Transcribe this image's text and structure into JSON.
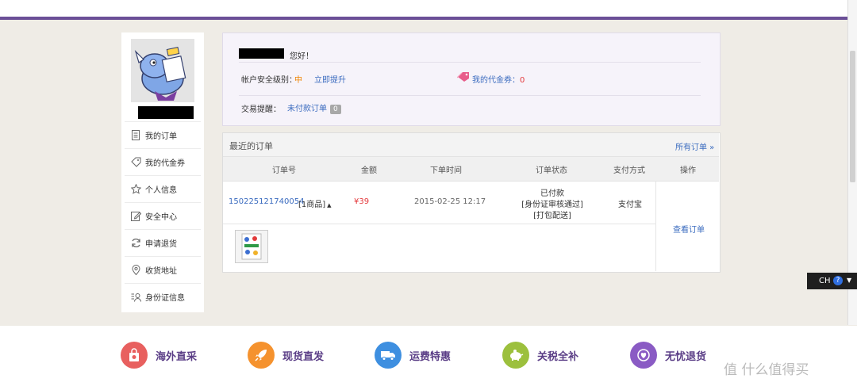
{
  "sidebar": {
    "items": [
      {
        "label": "我的订单",
        "icon": "document-icon"
      },
      {
        "label": "我的代金券",
        "icon": "tag-icon"
      },
      {
        "label": "个人信息",
        "icon": "star-icon"
      },
      {
        "label": "安全中心",
        "icon": "edit-icon"
      },
      {
        "label": "申请退货",
        "icon": "refresh-icon"
      },
      {
        "label": "收货地址",
        "icon": "location-pin-icon"
      },
      {
        "label": "身份证信息",
        "icon": "id-card-icon"
      }
    ]
  },
  "account": {
    "greeting": "您好！",
    "security_label": "帐户安全级别：",
    "security_level": "中",
    "upgrade_link": "立即提升",
    "coupon_label": "我的代金券：",
    "coupon_count": "0",
    "reminder_label": "交易提醒：",
    "unpaid_label": "未付款订单",
    "unpaid_count": "0"
  },
  "orders": {
    "title": "最近的订单",
    "all_link": "所有订单 »",
    "columns": [
      "订单号",
      "金额",
      "下单时间",
      "订单状态",
      "支付方式",
      "操作"
    ],
    "rows": [
      {
        "order_no": "150225121740054",
        "item_count": "[1商品]",
        "amount": "¥39",
        "time": "2015-02-25 12:17",
        "status": [
          "已付款",
          "[身份证审核通过]",
          "[打包配送]"
        ],
        "payment": "支付宝",
        "action": "查看订单"
      }
    ]
  },
  "features": [
    {
      "label": "海外直采",
      "color": "#e8605f",
      "icon": "shopping-bag-icon"
    },
    {
      "label": "现货直发",
      "color": "#f5922e",
      "icon": "rocket-icon"
    },
    {
      "label": "运费特惠",
      "color": "#3e8fe0",
      "icon": "truck-icon"
    },
    {
      "label": "关税全补",
      "color": "#9cc03d",
      "icon": "piggy-bank-icon"
    },
    {
      "label": "无忧退货",
      "color": "#8a5bc4",
      "icon": "heart-return-icon"
    }
  ],
  "ime": {
    "label": "CH",
    "help": "?"
  },
  "watermark": {
    "text": "值 什么值得买"
  }
}
